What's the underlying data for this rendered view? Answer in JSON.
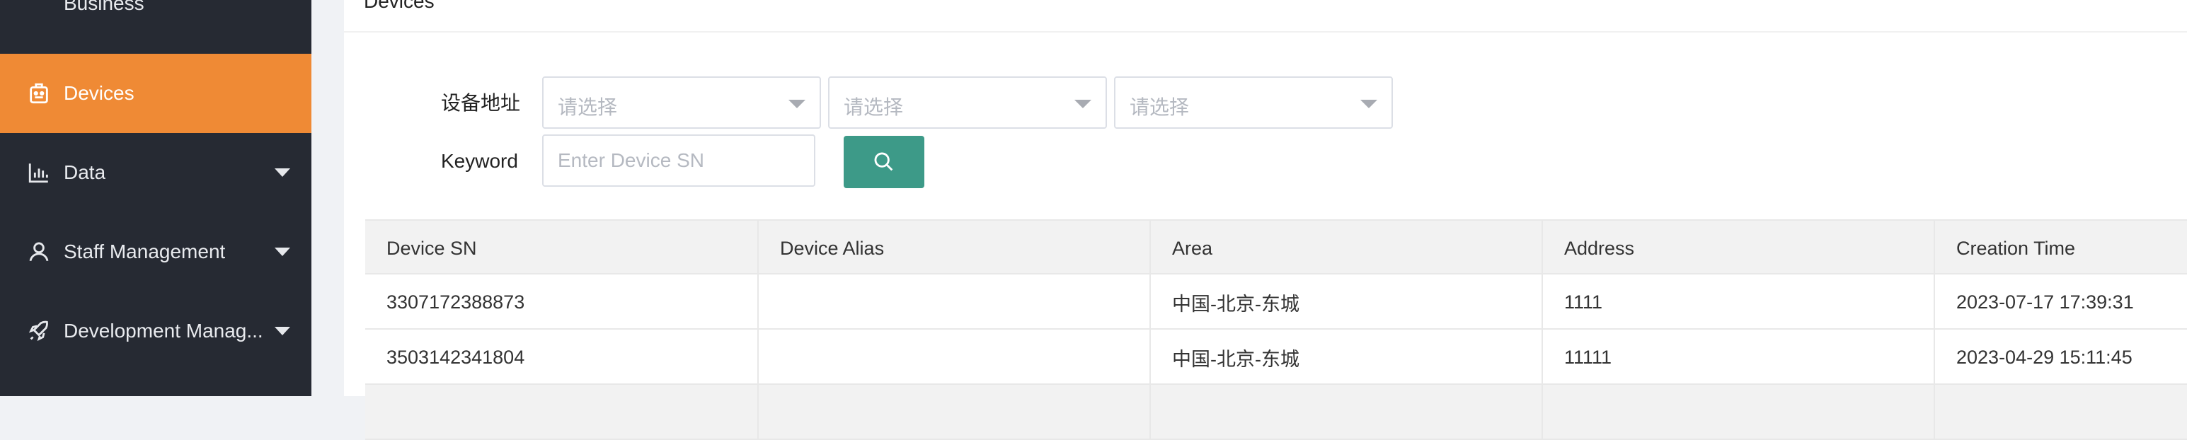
{
  "sidebar": {
    "items": [
      {
        "label": "Business",
        "icon": "business-icon"
      },
      {
        "label": "Devices",
        "icon": "devices-icon",
        "active": true
      },
      {
        "label": "Data",
        "icon": "bar-chart-icon"
      },
      {
        "label": "Staff Management",
        "icon": "user-icon"
      },
      {
        "label": "Development Manag...",
        "icon": "rocket-icon"
      }
    ]
  },
  "page": {
    "title": "Devices"
  },
  "filters": {
    "address_label": "设备地址",
    "select_placeholder": "请选择",
    "keyword_label": "Keyword",
    "keyword_placeholder": "Enter Device SN"
  },
  "table": {
    "headers": [
      "Device SN",
      "Device Alias",
      "Area",
      "Address",
      "Creation Time"
    ],
    "rows": [
      [
        "3307172388873",
        "",
        "中国-北京-东城",
        "1111",
        "2023-07-17 17:39:31"
      ],
      [
        "3503142341804",
        "",
        "中国-北京-东城",
        "11111",
        "2023-04-29 15:11:45"
      ]
    ]
  },
  "colors": {
    "accent": "#ef8a35",
    "sidebar_bg": "#262a33",
    "primary_button": "#3d9a88"
  }
}
